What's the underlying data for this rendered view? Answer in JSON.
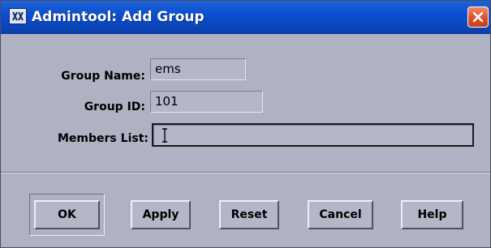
{
  "window": {
    "title": "Admintool: Add Group"
  },
  "form": {
    "group_name_label": "Group Name:",
    "group_name_value": "ems",
    "group_id_label": "Group ID:",
    "group_id_value": "101",
    "members_list_label": "Members List:",
    "members_list_value": ""
  },
  "buttons": {
    "ok": "OK",
    "apply": "Apply",
    "reset": "Reset",
    "cancel": "Cancel",
    "help": "Help"
  },
  "icons": {
    "app_icon": "admintool-window-icon",
    "close": "close-icon"
  },
  "colors": {
    "titlebar": "#0b4fcf",
    "close_button": "#e0532e",
    "window_background": "#aeb2c3"
  }
}
